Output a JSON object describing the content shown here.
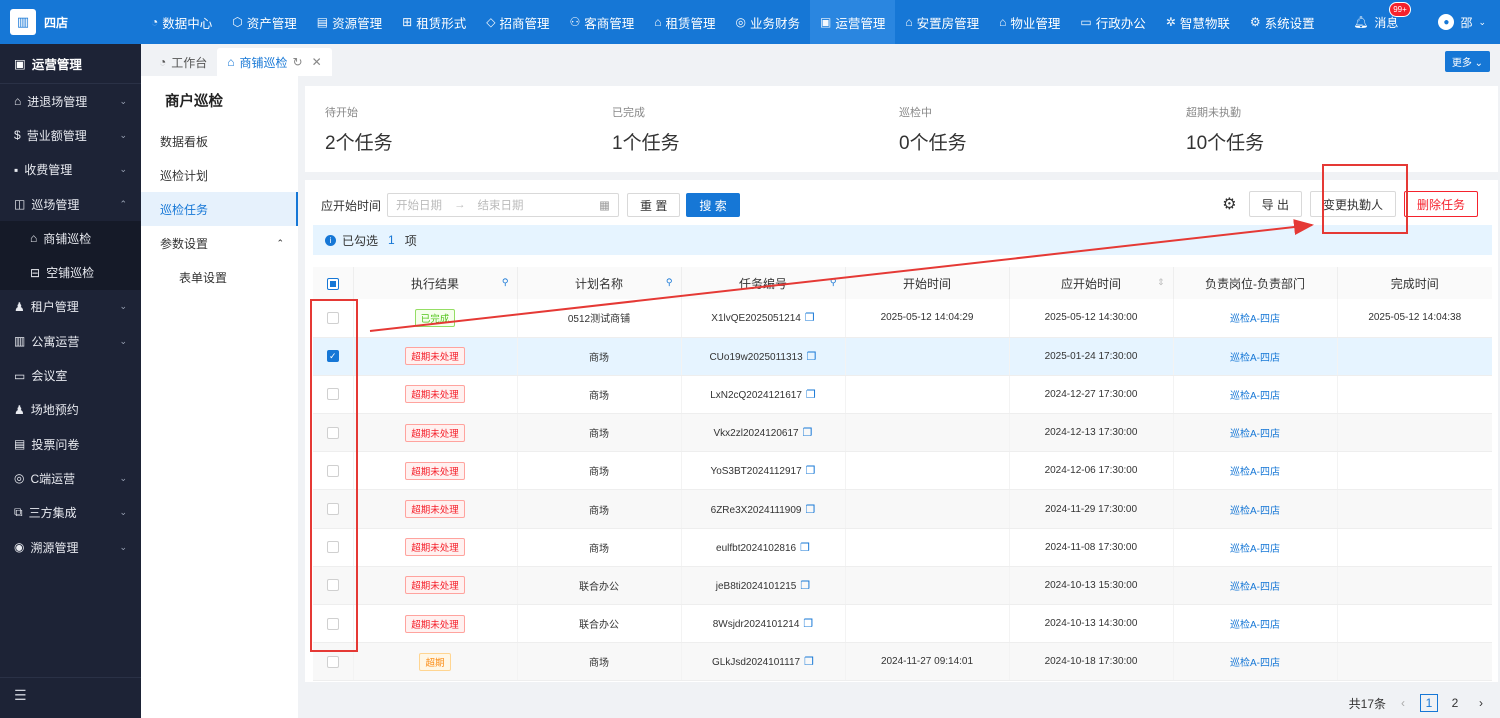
{
  "app": {
    "logo_text": "四店"
  },
  "topnav": [
    {
      "icon": "◔",
      "label": "数据中心"
    },
    {
      "icon": "⬡",
      "label": "资产管理"
    },
    {
      "icon": "▤",
      "label": "资源管理"
    },
    {
      "icon": "⊞",
      "label": "租赁形式"
    },
    {
      "icon": "◇",
      "label": "招商管理"
    },
    {
      "icon": "⚇",
      "label": "客商管理"
    },
    {
      "icon": "⌂",
      "label": "租赁管理"
    },
    {
      "icon": "◎",
      "label": "业务财务"
    },
    {
      "icon": "▣",
      "label": "运营管理"
    },
    {
      "icon": "⌂",
      "label": "安置房管理"
    },
    {
      "icon": "⌂",
      "label": "物业管理"
    },
    {
      "icon": "▭",
      "label": "行政办公"
    },
    {
      "icon": "✲",
      "label": "智慧物联"
    },
    {
      "icon": "⚙",
      "label": "系统设置"
    }
  ],
  "header": {
    "msg_label": "消息",
    "msg_badge": "99+",
    "user_name": "邵"
  },
  "sidebar": {
    "title": "运营管理",
    "items": [
      {
        "icon": "⌂",
        "label": "进退场管理",
        "arrow": "⌄"
      },
      {
        "icon": "$",
        "label": "营业额管理",
        "arrow": "⌄"
      },
      {
        "icon": "▪",
        "label": "收费管理",
        "arrow": "⌄"
      },
      {
        "icon": "◫",
        "label": "巡场管理",
        "arrow": "⌃"
      },
      {
        "icon": "⌂",
        "label": "商铺巡检",
        "arrow": ""
      },
      {
        "icon": "⊟",
        "label": "空铺巡检",
        "arrow": ""
      },
      {
        "icon": "♟",
        "label": "租户管理",
        "arrow": "⌄"
      },
      {
        "icon": "▥",
        "label": "公寓运营",
        "arrow": "⌄"
      },
      {
        "icon": "▭",
        "label": "会议室",
        "arrow": ""
      },
      {
        "icon": "♟",
        "label": "场地预约",
        "arrow": ""
      },
      {
        "icon": "▤",
        "label": "投票问卷",
        "arrow": ""
      },
      {
        "icon": "◎",
        "label": "C端运营",
        "arrow": "⌄"
      },
      {
        "icon": "⧉",
        "label": "三方集成",
        "arrow": "⌄"
      },
      {
        "icon": "◉",
        "label": "溯源管理",
        "arrow": "⌄"
      }
    ],
    "fold_icon": "☰"
  },
  "tabs": [
    {
      "icon": "◔",
      "label": "工作台"
    },
    {
      "icon": "⌂",
      "label": "商铺巡检",
      "refresh": "↻",
      "close": "✕"
    }
  ],
  "more_label": "更多 ⌄",
  "subnav": {
    "title": "商户巡检",
    "items": [
      {
        "label": "数据看板",
        "arrow": ""
      },
      {
        "label": "巡检计划",
        "arrow": ""
      },
      {
        "label": "巡检任务",
        "arrow": ""
      },
      {
        "label": "参数设置",
        "arrow": "⌃"
      },
      {
        "label": "表单设置",
        "arrow": ""
      }
    ]
  },
  "stats": [
    {
      "label": "待开始",
      "value": "2个任务"
    },
    {
      "label": "已完成",
      "value": "1个任务"
    },
    {
      "label": "巡检中",
      "value": "0个任务"
    },
    {
      "label": "超期未执勤",
      "value": "10个任务"
    }
  ],
  "filter": {
    "label": "应开始时间",
    "start_placeholder": "开始日期",
    "sep": "→",
    "end_placeholder": "结束日期",
    "cal_icon": "▦",
    "reset": "重 置",
    "search": "搜 索"
  },
  "actions": {
    "gear_icon": "⚙",
    "export": "导 出",
    "change": "变更执勤人",
    "delete": "删除任务"
  },
  "selection": {
    "icon": "i",
    "text1": "已勾选",
    "count": "1",
    "text2": "项"
  },
  "table": {
    "headers": [
      "执行结果",
      "计划名称",
      "任务编号",
      "开始时间",
      "应开始时间",
      "负责岗位-负责部门",
      "完成时间"
    ],
    "filter_icon": "🔍",
    "rows": [
      {
        "status": "已完成",
        "type": "done",
        "plan": "0512测试商铺",
        "code": "X1lvQE2025051214",
        "start": "2025-05-12 14:04:29",
        "due": "2025-05-12 14:30:00",
        "dept": "巡检A-四店",
        "finish": "2025-05-12 14:04:38",
        "checked": false
      },
      {
        "status": "超期未处理",
        "type": "over",
        "plan": "商场",
        "code": "CUo19w2025011313",
        "start": "",
        "due": "2025-01-24 17:30:00",
        "dept": "巡检A-四店",
        "finish": "",
        "checked": true
      },
      {
        "status": "超期未处理",
        "type": "over",
        "plan": "商场",
        "code": "LxN2cQ2024121617",
        "start": "",
        "due": "2024-12-27 17:30:00",
        "dept": "巡检A-四店",
        "finish": "",
        "checked": false
      },
      {
        "status": "超期未处理",
        "type": "over",
        "plan": "商场",
        "code": "Vkx2zl2024120617",
        "start": "",
        "due": "2024-12-13 17:30:00",
        "dept": "巡检A-四店",
        "finish": "",
        "checked": false
      },
      {
        "status": "超期未处理",
        "type": "over",
        "plan": "商场",
        "code": "YoS3BT2024112917",
        "start": "",
        "due": "2024-12-06 17:30:00",
        "dept": "巡检A-四店",
        "finish": "",
        "checked": false
      },
      {
        "status": "超期未处理",
        "type": "over",
        "plan": "商场",
        "code": "6ZRe3X2024111909",
        "start": "",
        "due": "2024-11-29 17:30:00",
        "dept": "巡检A-四店",
        "finish": "",
        "checked": false
      },
      {
        "status": "超期未处理",
        "type": "over",
        "plan": "商场",
        "code": "eulfbt2024102816",
        "start": "",
        "due": "2024-11-08 17:30:00",
        "dept": "巡检A-四店",
        "finish": "",
        "checked": false
      },
      {
        "status": "超期未处理",
        "type": "over",
        "plan": "联合办公",
        "code": "jeB8ti2024101215",
        "start": "",
        "due": "2024-10-13 15:30:00",
        "dept": "巡检A-四店",
        "finish": "",
        "checked": false
      },
      {
        "status": "超期未处理",
        "type": "over",
        "plan": "联合办公",
        "code": "8Wsjdr2024101214",
        "start": "",
        "due": "2024-10-13 14:30:00",
        "dept": "巡检A-四店",
        "finish": "",
        "checked": false
      },
      {
        "status": "超期",
        "type": "late",
        "plan": "商场",
        "code": "GLkJsd2024101117",
        "start": "2024-11-27 09:14:01",
        "due": "2024-10-18 17:30:00",
        "dept": "巡检A-四店",
        "finish": "",
        "checked": false
      }
    ],
    "copy_icon": "❐"
  },
  "pagination": {
    "total": "共17条",
    "prev": "‹",
    "pages": [
      "1",
      "2"
    ],
    "next": "›"
  }
}
